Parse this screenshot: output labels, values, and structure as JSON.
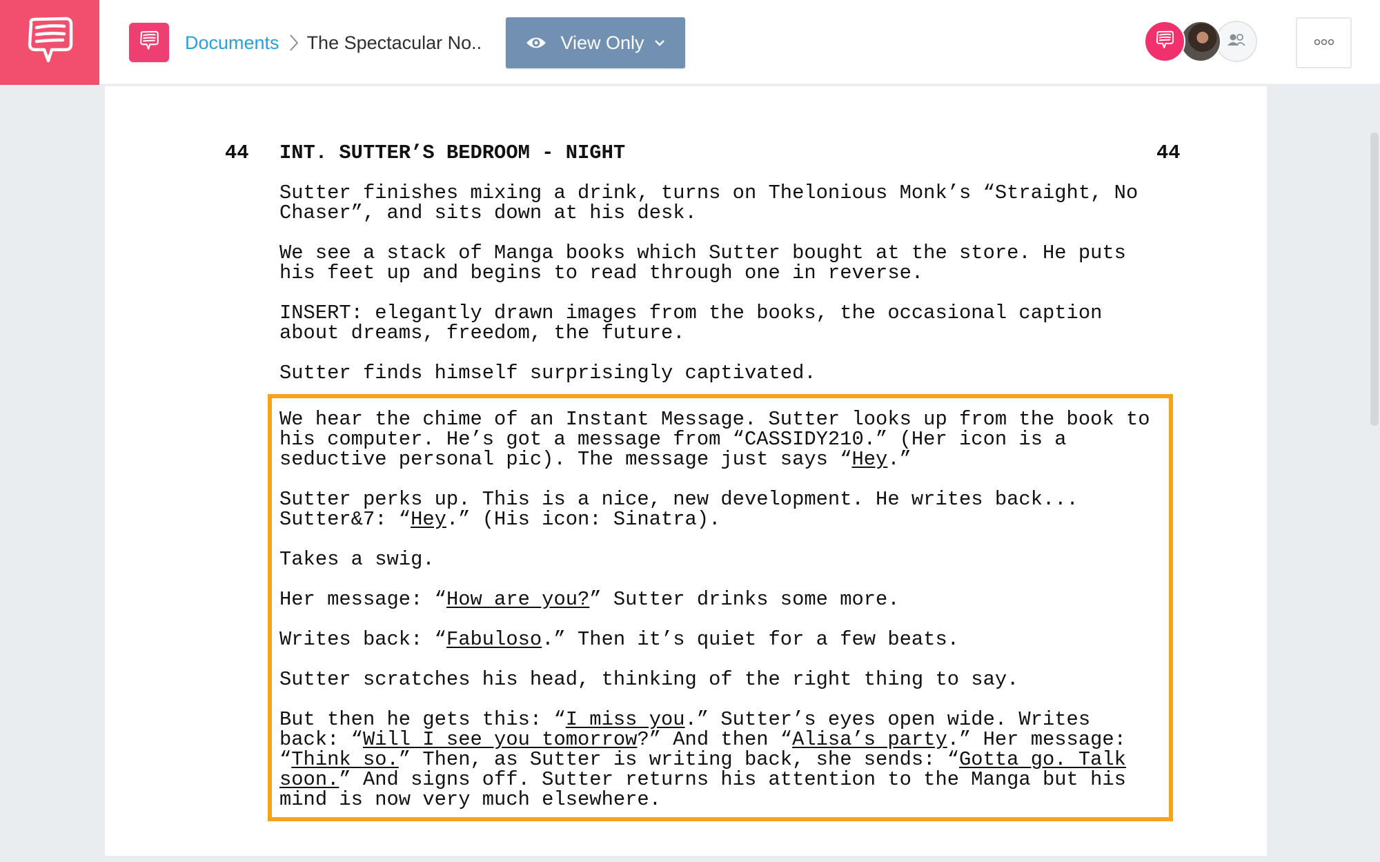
{
  "header": {
    "app_logo_icon": "speech-bubble-logo-icon",
    "doc_icon": "speech-bubble-doc-icon",
    "breadcrumb": {
      "root": "Documents",
      "separator_icon": "chevron-right-icon",
      "current": "The Spectacular No.."
    },
    "view_mode": {
      "icon": "eye-icon",
      "label": "View Only",
      "dropdown_icon": "chevron-down-icon"
    },
    "collaborators": [
      {
        "type": "app",
        "icon": "speech-bubble-icon"
      },
      {
        "type": "user-photo",
        "icon": "avatar-photo"
      },
      {
        "type": "share",
        "icon": "users-icon"
      }
    ],
    "menu_icon": "more-options-icon"
  },
  "colors": {
    "brand": "#f24e6e",
    "doc_icon": "#ee3f72",
    "link": "#2a9fd8",
    "view_button": "#7291b2",
    "highlight": "#f7a21b",
    "background": "#e9edf0"
  },
  "script": {
    "scene_number": "44",
    "scene_heading": "INT. SUTTER’S BEDROOM - NIGHT",
    "paragraphs_before": [
      [
        "Sutter finishes mixing a drink, turns on Thelonious Monk’s “Straight, No",
        "Chaser”, and sits down at his desk."
      ],
      [
        "We see a stack of Manga books which Sutter bought at the store. He puts",
        "his feet up and begins to read through one in reverse."
      ],
      [
        "INSERT: elegantly drawn images from the books, the occasional caption",
        "about dreams, freedom, the future."
      ],
      [
        "Sutter finds himself surprisingly captivated."
      ]
    ],
    "highlighted_paragraphs": [
      [
        [
          {
            "t": "We hear the chime of an Instant Message. Sutter looks up from the book to"
          }
        ],
        [
          {
            "t": "his computer. He’s got a message from “CASSIDY210.” (Her icon is a"
          }
        ],
        [
          {
            "t": "seductive personal pic). The message just says “"
          },
          {
            "t": "Hey",
            "u": true
          },
          {
            "t": ".”"
          }
        ]
      ],
      [
        [
          {
            "t": "Sutter perks up. This is a nice, new development. He writes back..."
          }
        ],
        [
          {
            "t": "Sutter&7: “"
          },
          {
            "t": "Hey",
            "u": true
          },
          {
            "t": ".” (His icon: Sinatra)."
          }
        ]
      ],
      [
        [
          {
            "t": "Takes a swig."
          }
        ]
      ],
      [
        [
          {
            "t": "Her message: “"
          },
          {
            "t": "How are you?",
            "u": true
          },
          {
            "t": "” Sutter drinks some more."
          }
        ]
      ],
      [
        [
          {
            "t": "Writes back: “"
          },
          {
            "t": "Fabuloso",
            "u": true
          },
          {
            "t": ".” Then it’s quiet for a few beats."
          }
        ]
      ],
      [
        [
          {
            "t": "Sutter scratches his head, thinking of the right thing to say."
          }
        ]
      ],
      [
        [
          {
            "t": "But then he gets this: “"
          },
          {
            "t": "I miss you",
            "u": true
          },
          {
            "t": ".” Sutter’s eyes open wide. Writes"
          }
        ],
        [
          {
            "t": "back: “"
          },
          {
            "t": "Will I see you tomorrow",
            "u": true
          },
          {
            "t": "?” And then “"
          },
          {
            "t": "Alisa’s party",
            "u": true
          },
          {
            "t": ".” Her message:"
          }
        ],
        [
          {
            "t": "“"
          },
          {
            "t": "Think so.",
            "u": true
          },
          {
            "t": "” Then, as Sutter is writing back, she sends: “"
          },
          {
            "t": "Gotta go. Talk",
            "u": true
          }
        ],
        [
          {
            "t": "soon.",
            "u": true
          },
          {
            "t": "” And signs off. Sutter returns his attention to the Manga but his"
          }
        ],
        [
          {
            "t": "mind is now very much elsewhere."
          }
        ]
      ]
    ]
  }
}
